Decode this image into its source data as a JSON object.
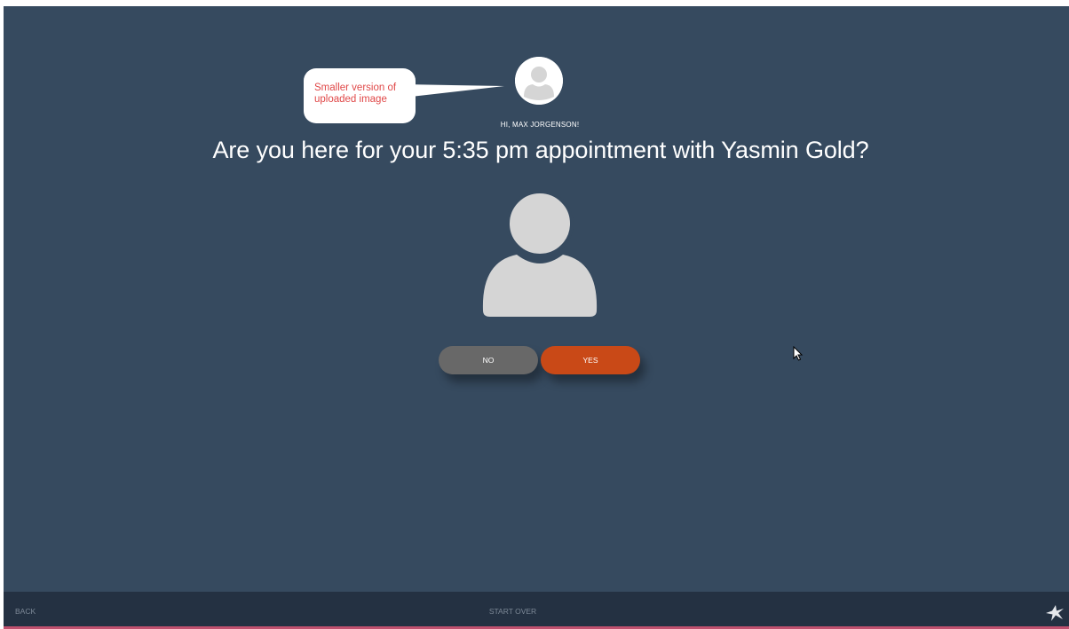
{
  "annotation": {
    "callout_text": "Smaller version of uploaded image"
  },
  "header": {
    "greeting": "HI, MAX JORGENSON!",
    "question": "Are you here for your 5:35 pm appointment with Yasmin Gold?"
  },
  "actions": {
    "no_label": "NO",
    "yes_label": "YES"
  },
  "footer": {
    "back_label": "BACK",
    "start_over_label": "START OVER",
    "logo_icon": "starburst-logo-icon"
  },
  "colors": {
    "background": "#364a5f",
    "footer": "#243142",
    "accent_yes": "#c94917",
    "button_no": "#686868",
    "callout_text": "#e04848",
    "footer_strip": "#c0516f"
  }
}
